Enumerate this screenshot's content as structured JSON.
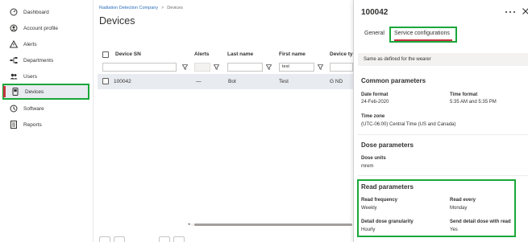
{
  "sidebar": {
    "items": [
      {
        "label": "Dashboard",
        "icon": "dashboard-icon"
      },
      {
        "label": "Account profile",
        "icon": "account-icon"
      },
      {
        "label": "Alerts",
        "icon": "alert-icon"
      },
      {
        "label": "Departments",
        "icon": "departments-icon"
      },
      {
        "label": "Users",
        "icon": "users-icon"
      },
      {
        "label": "Devices",
        "icon": "device-icon"
      },
      {
        "label": "Software",
        "icon": "software-icon"
      },
      {
        "label": "Reports",
        "icon": "reports-icon"
      }
    ],
    "active": "Devices"
  },
  "breadcrumb": {
    "parent": "Radiation Detection Company",
    "separator": ">",
    "current": "Devices"
  },
  "page": {
    "title": "Devices"
  },
  "table": {
    "columns": [
      "Device SN",
      "Alerts",
      "Last name",
      "First name",
      "Device typ"
    ],
    "filters": {
      "first_name": "test"
    },
    "rows": [
      {
        "device_sn": "100042",
        "alerts": "—",
        "last_name": "Bot",
        "first_name": "Test",
        "device_type": "G ND"
      }
    ]
  },
  "panel": {
    "title": "100042",
    "tabs": {
      "general": "General",
      "service": "Service configurations"
    },
    "info": "Same as defined for the wearer",
    "common": {
      "title": "Common parameters",
      "date_format_label": "Date format",
      "date_format_value": "24-Feb-2020",
      "time_format_label": "Time format",
      "time_format_value": "5:35 AM and 5:35 PM",
      "time_zone_label": "Time zone",
      "time_zone_value": "(UTC-06:00) Central Time (US and Canada)"
    },
    "dose": {
      "title": "Dose parameters",
      "units_label": "Dose units",
      "units_value": "mrem"
    },
    "read": {
      "title": "Read parameters",
      "frequency_label": "Read frequency",
      "frequency_value": "Weekly",
      "every_label": "Read every",
      "every_value": "Monday",
      "granularity_label": "Detail dose granularity",
      "granularity_value": "Hourly",
      "send_label": "Send detail dose with read",
      "send_value": "Yes"
    }
  },
  "colors": {
    "accent": "#c8323f",
    "highlight": "#1aa73a",
    "link": "#2a6ebb"
  }
}
